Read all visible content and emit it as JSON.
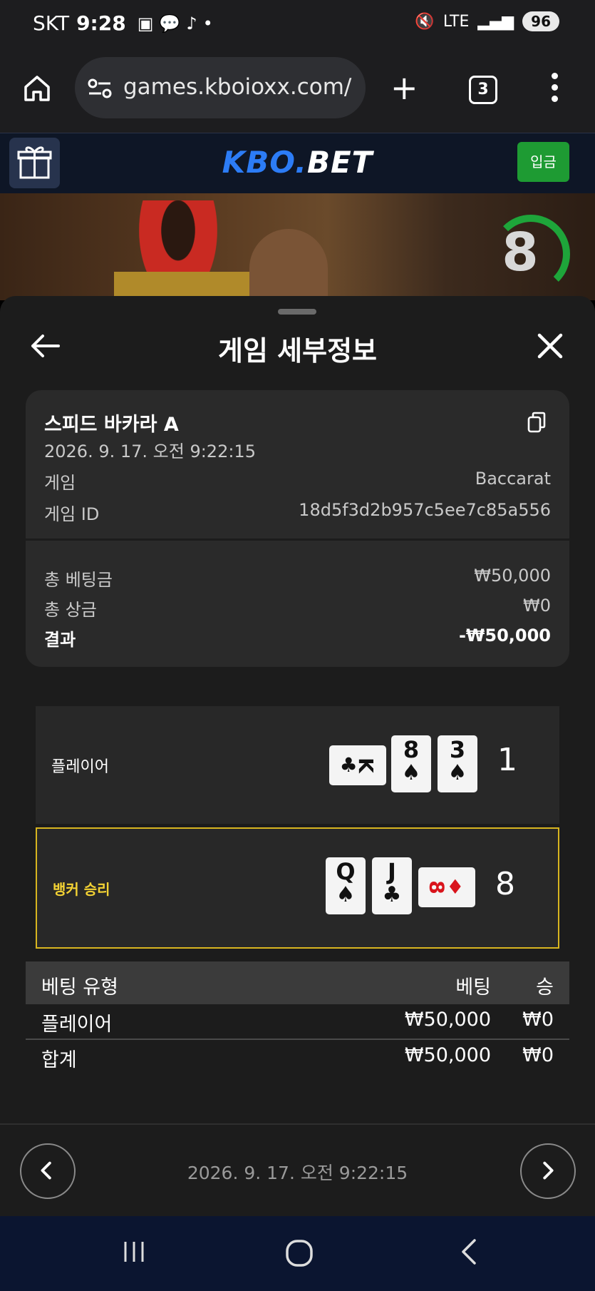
{
  "status_bar": {
    "carrier": "SKT",
    "time": "9:28",
    "network": "LTE",
    "battery": "96"
  },
  "browser": {
    "url": "games.kboioxx.com/",
    "tab_count": "3"
  },
  "site": {
    "logo_part1": "KBO.",
    "logo_part2": "BET",
    "deposit_label": "입금"
  },
  "video": {
    "timer_value": "8"
  },
  "sheet": {
    "title": "게임 세부정보",
    "game_name": "스피드 바카라 A",
    "game_datetime": "2026. 9. 17. 오전 9:22:15",
    "details": [
      {
        "label": "게임",
        "value": "Baccarat"
      },
      {
        "label": "게임 ID",
        "value": "18d5f3d2b957c5ee7c85a556"
      }
    ],
    "summary": [
      {
        "label": "총 베팅금",
        "value": "₩50,000"
      },
      {
        "label": "총 상금",
        "value": "₩0"
      },
      {
        "label": "결과",
        "value": "-₩50,000"
      }
    ]
  },
  "result": {
    "player": {
      "label": "플레이어",
      "score": "1",
      "cards": [
        {
          "rank": "K",
          "suit": "♣",
          "color": "black",
          "orientation": "sideways"
        },
        {
          "rank": "8",
          "suit": "♠",
          "color": "black"
        },
        {
          "rank": "3",
          "suit": "♠",
          "color": "black"
        }
      ]
    },
    "banker": {
      "label": "뱅커 승리",
      "score": "8",
      "cards": [
        {
          "rank": "Q",
          "suit": "♠",
          "color": "black"
        },
        {
          "rank": "J",
          "suit": "♣",
          "color": "black"
        },
        {
          "rank": "8",
          "suit": "♦",
          "color": "red",
          "orientation": "sideways"
        }
      ]
    }
  },
  "bets": {
    "headers": {
      "type": "베팅 유형",
      "bet": "베팅",
      "win": "승"
    },
    "rows": [
      {
        "type": "플레이어",
        "bet": "₩50,000",
        "win": "₩0"
      }
    ],
    "total": {
      "type": "합계",
      "bet": "₩50,000",
      "win": "₩0"
    }
  },
  "footer": {
    "datetime": "2026. 9. 17. 오전 9:22:15"
  },
  "colors": {
    "accent_blue": "#2c7cf6",
    "deposit_green": "#1e9b33",
    "winner_gold": "#f3d234"
  }
}
